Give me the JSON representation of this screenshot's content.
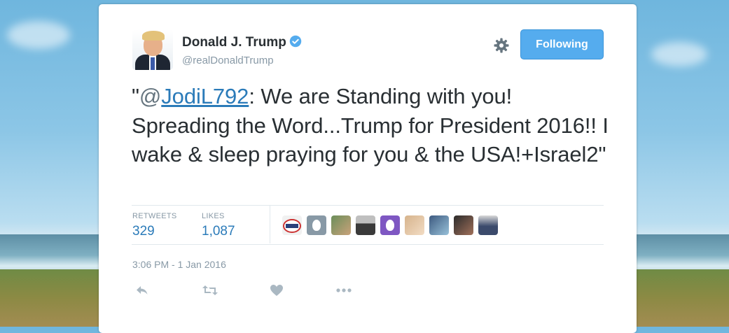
{
  "user": {
    "name": "Donald J. Trump",
    "handle": "@realDonaldTrump",
    "verified": true
  },
  "follow_button": {
    "label": "Following"
  },
  "tweet": {
    "open_quote": "\"",
    "mention_at": "@",
    "mention_user": "JodiL792",
    "body": ": We are Standing with you! Spreading the Word...Trump for President 2016!! I wake & sleep praying for you & the USA!+Israel2\""
  },
  "stats": {
    "retweets_label": "RETWEETS",
    "retweets_value": "329",
    "likes_label": "LIKES",
    "likes_value": "1,087"
  },
  "liked_by_avatars": [
    "avatar-1",
    "avatar-2",
    "avatar-3",
    "avatar-4",
    "avatar-5",
    "avatar-6",
    "avatar-7",
    "avatar-8",
    "avatar-9"
  ],
  "timestamp": "3:06 PM - 1 Jan 2016",
  "actions": [
    "reply-icon",
    "retweet-icon",
    "like-icon",
    "more-icon"
  ],
  "colors": {
    "accent": "#55acee",
    "link": "#2b7bb9",
    "text": "#292f33",
    "muted": "#8899a6",
    "divider": "#e1e8ed"
  }
}
